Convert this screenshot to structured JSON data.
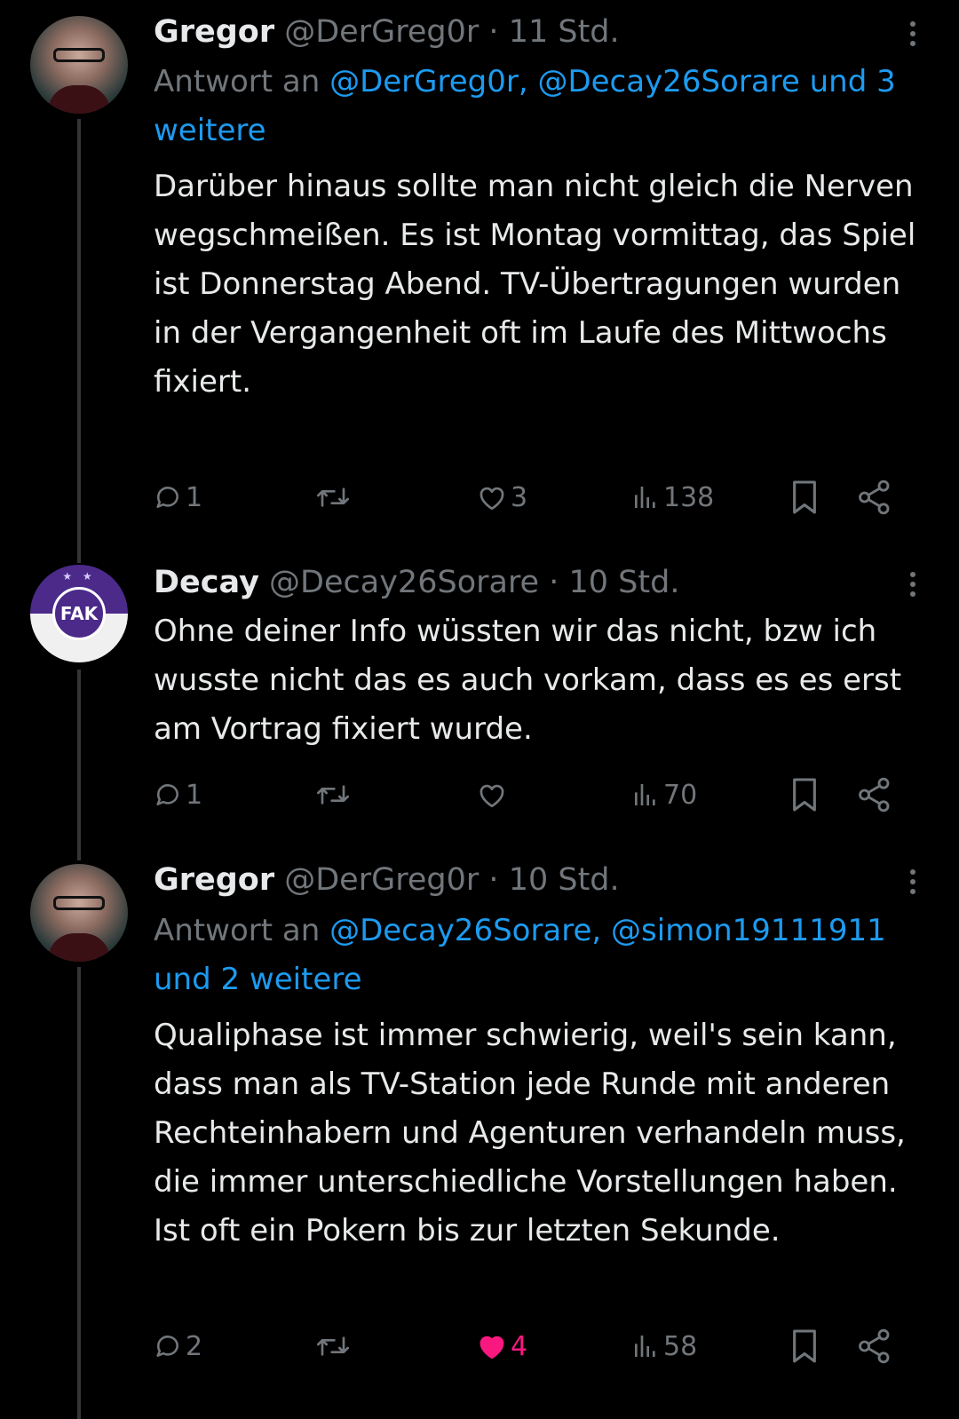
{
  "tweets": [
    {
      "name": "Gregor",
      "handle": "@DerGreg0r",
      "sep": "·",
      "time": "11 Std.",
      "reply_prefix": "Antwort an ",
      "reply_mentions": "@DerGreg0r, @Decay26Sorare und 3 weitere",
      "body": "Darüber hinaus sollte man nicht gleich die Nerven wegschmeißen. Es ist Montag vormittag, das Spiel ist Donnerstag Abend. TV-Übertragungen wurden in der Vergangenheit oft im Laufe des Mittwochs fixiert.",
      "replies": "1",
      "reposts": "",
      "likes": "3",
      "views": "138",
      "liked": false
    },
    {
      "name": "Decay",
      "handle": "@Decay26Sorare",
      "sep": "·",
      "time": "10 Std.",
      "body": "Ohne deiner Info wüssten wir das nicht, bzw ich wusste nicht das es auch vorkam, dass es es erst am Vortrag fixiert wurde.",
      "avatar_text": "FAK",
      "replies": "1",
      "reposts": "",
      "likes": "",
      "views": "70",
      "liked": false
    },
    {
      "name": "Gregor",
      "handle": "@DerGreg0r",
      "sep": "·",
      "time": "10 Std.",
      "reply_prefix": "Antwort an ",
      "reply_mentions": "@Decay26Sorare, @simon19111911 und 2 weitere",
      "body": "Qualiphase ist immer schwierig, weil's sein kann, dass man als TV-Station jede Runde mit anderen Rechteinhabern und Agenturen verhandeln muss, die immer unterschiedliche Vorstellungen haben. Ist oft ein Pokern bis zur letzten Sekunde.",
      "replies": "2",
      "reposts": "",
      "likes": "4",
      "views": "58",
      "liked": true
    }
  ],
  "colors": {
    "background": "#000000",
    "text": "#e7e9ea",
    "muted": "#71767b",
    "link": "#1d9bf0",
    "like": "#f91880",
    "thread_line": "#333639"
  },
  "icons": [
    "more-icon",
    "reply-icon",
    "repost-icon",
    "like-icon",
    "views-icon",
    "bookmark-icon",
    "share-icon"
  ]
}
